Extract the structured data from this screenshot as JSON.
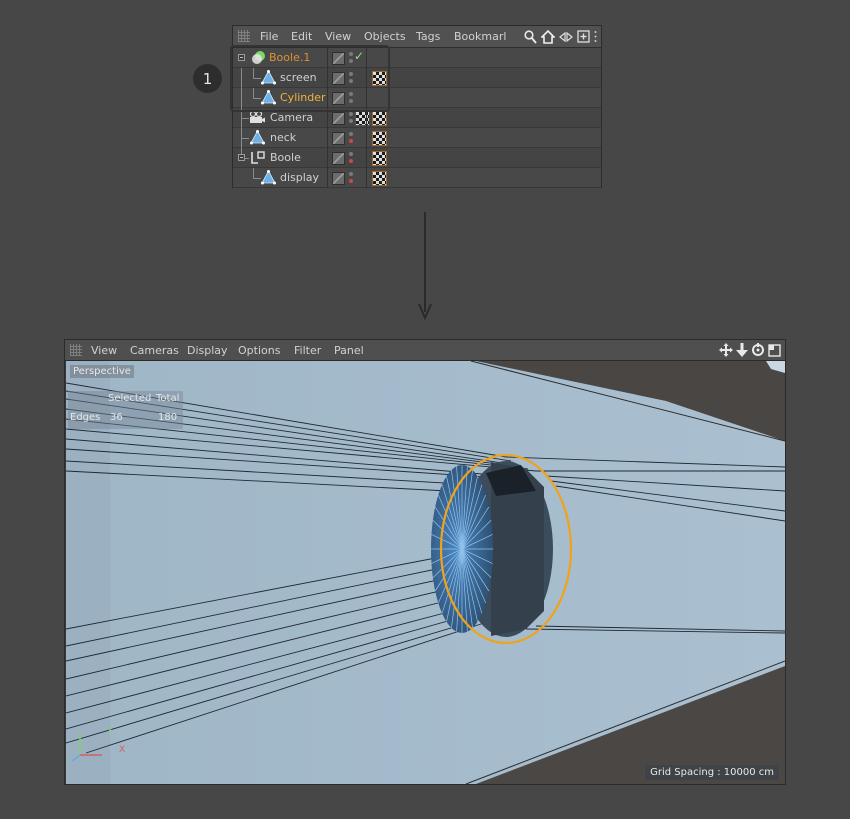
{
  "object_manager": {
    "menu": [
      "File",
      "Edit",
      "View",
      "Objects",
      "Tags",
      "Bookmarl"
    ],
    "toolbar_icons": [
      "search-icon",
      "home-icon",
      "back-forth-icon",
      "new-window-icon",
      "more-icon"
    ],
    "objects": [
      {
        "name": "Boole.1",
        "level": 0,
        "icon": "boole-icon",
        "tag": "check",
        "color": "#e0912f"
      },
      {
        "name": "screen",
        "level": 1,
        "icon": "polygon-icon",
        "tag": "texture"
      },
      {
        "name": "Cylinder",
        "level": 1,
        "icon": "polygon-icon",
        "tag": "none",
        "color": "#f2b13a"
      },
      {
        "name": "Camera",
        "level": 0,
        "icon": "camera-icon",
        "tag": "texture"
      },
      {
        "name": "neck",
        "level": 0,
        "icon": "polygon-icon",
        "tag": "texture"
      },
      {
        "name": "Boole",
        "level": 0,
        "icon": "boole-icon",
        "tag": "texture"
      },
      {
        "name": "display",
        "level": 1,
        "icon": "polygon-icon",
        "tag": "texture"
      }
    ]
  },
  "step_badge": "1",
  "viewport": {
    "menu": [
      "View",
      "Cameras",
      "Display",
      "Options",
      "Filter",
      "Panel"
    ],
    "toolbar_icons": [
      "move-icon",
      "down-arrow-icon",
      "rotate-icon",
      "maximize-icon"
    ],
    "camera_label": "Perspective",
    "stats": {
      "header_selected": "Selected",
      "header_total": "Total",
      "row_label": "Edges",
      "selected_value": "36",
      "total_value": "180"
    },
    "grid_spacing": "Grid Spacing : 10000 cm",
    "axis_labels": {
      "x": "X",
      "y": "Y"
    },
    "colors": {
      "background": "#a9bfd0",
      "selection_ring": "#f0a21a",
      "cylinder_face": "#3f6e9c"
    }
  }
}
